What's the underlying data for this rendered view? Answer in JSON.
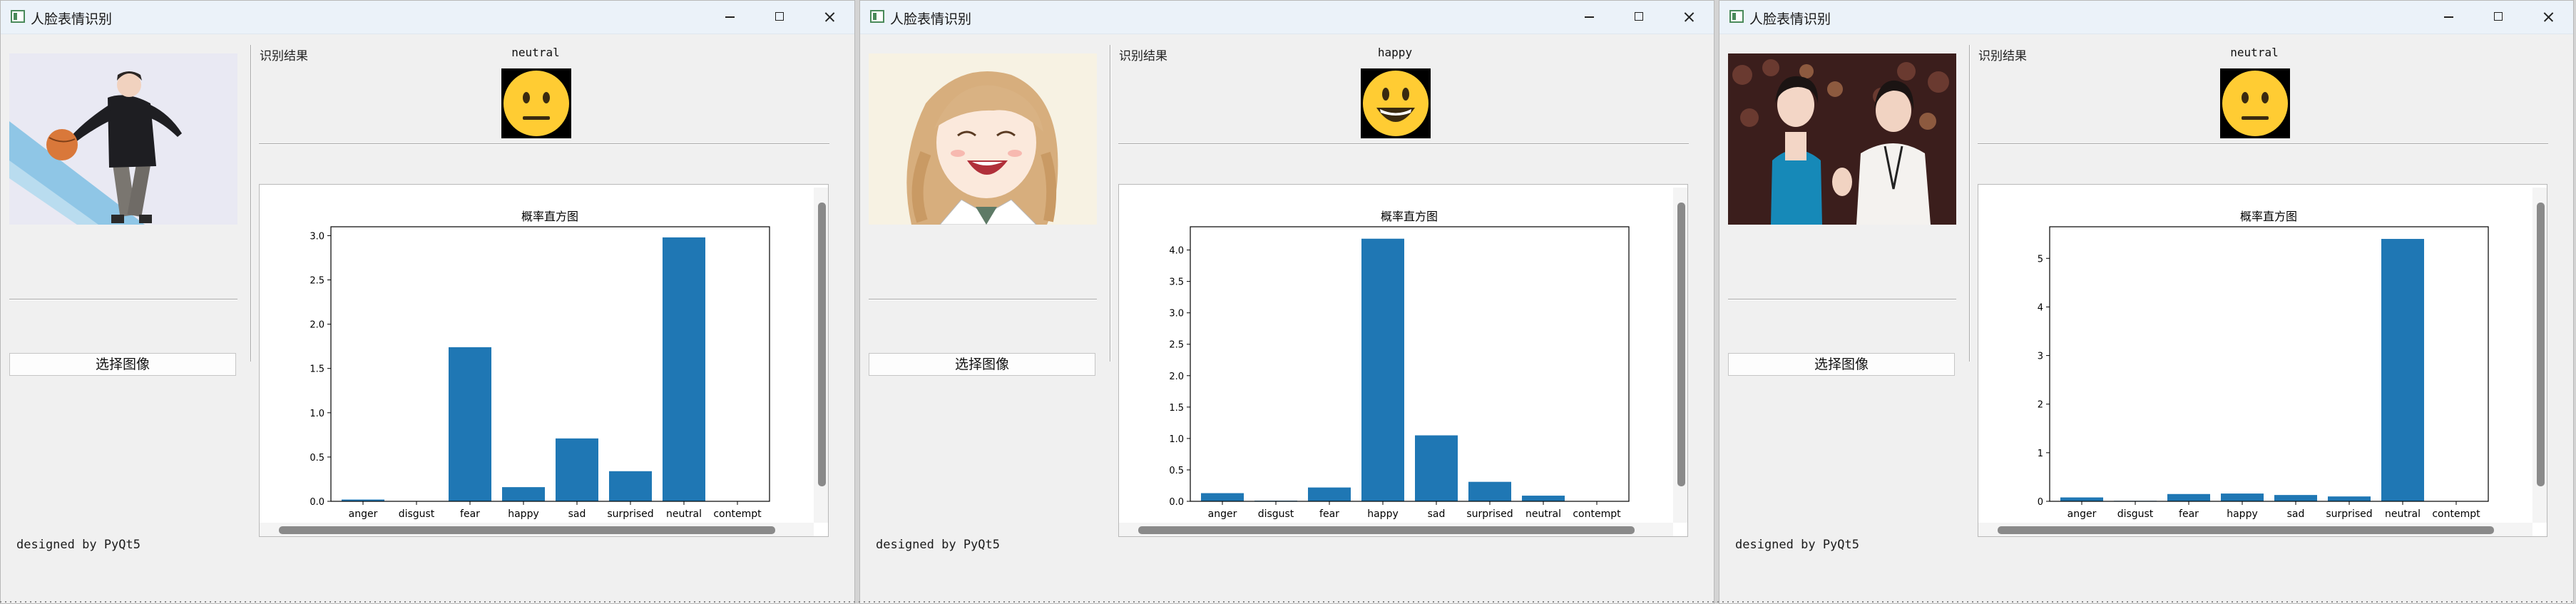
{
  "windows": [
    {
      "title": "人脸表情识别",
      "result_label": "识别结果",
      "emotion": "neutral",
      "emoji_icon": "neutral-face-emoji-icon",
      "photo": "photo-person-dancing",
      "select_button": "选择图像",
      "footer": "designed by PyQt5",
      "chart_data": {
        "type": "bar",
        "title": "概率直方图",
        "categories": [
          "anger",
          "disgust",
          "fear",
          "happy",
          "sad",
          "surprised",
          "neutral",
          "contempt"
        ],
        "values": [
          0.02,
          0.0,
          1.74,
          0.16,
          0.71,
          0.34,
          2.98,
          0.0
        ],
        "ylim": [
          0,
          3.1
        ],
        "yticks": [
          "0.0",
          "0.5",
          "1.0",
          "1.5",
          "2.0",
          "2.5",
          "3.0"
        ],
        "bar_color": "#1f77b4"
      }
    },
    {
      "title": "人脸表情识别",
      "result_label": "识别结果",
      "emotion": "happy",
      "emoji_icon": "happy-face-emoji-icon",
      "photo": "photo-anime-girl-laughing",
      "select_button": "选择图像",
      "footer": "designed by PyQt5",
      "chart_data": {
        "type": "bar",
        "title": "概率直方图",
        "categories": [
          "anger",
          "disgust",
          "fear",
          "happy",
          "sad",
          "surprised",
          "neutral",
          "contempt"
        ],
        "values": [
          0.13,
          0.01,
          0.22,
          4.18,
          1.05,
          0.31,
          0.09,
          0.0
        ],
        "ylim": [
          0,
          4.37
        ],
        "yticks": [
          "0.0",
          "0.5",
          "1.0",
          "1.5",
          "2.0",
          "2.5",
          "3.0",
          "3.5",
          "4.0"
        ],
        "bar_color": "#1f77b4"
      }
    },
    {
      "title": "人脸表情识别",
      "result_label": "识别结果",
      "emotion": "neutral",
      "emoji_icon": "neutral-face-emoji-icon",
      "photo": "photo-audience-clapping",
      "select_button": "选择图像",
      "footer": "designed by PyQt5",
      "chart_data": {
        "type": "bar",
        "title": "概率直方图",
        "categories": [
          "anger",
          "disgust",
          "fear",
          "happy",
          "sad",
          "surprised",
          "neutral",
          "contempt"
        ],
        "values": [
          0.08,
          0.01,
          0.15,
          0.16,
          0.13,
          0.1,
          5.4,
          0.0
        ],
        "ylim": [
          0,
          5.65
        ],
        "yticks": [
          "0",
          "1",
          "2",
          "3",
          "4",
          "5"
        ],
        "bar_color": "#1f77b4"
      }
    }
  ]
}
